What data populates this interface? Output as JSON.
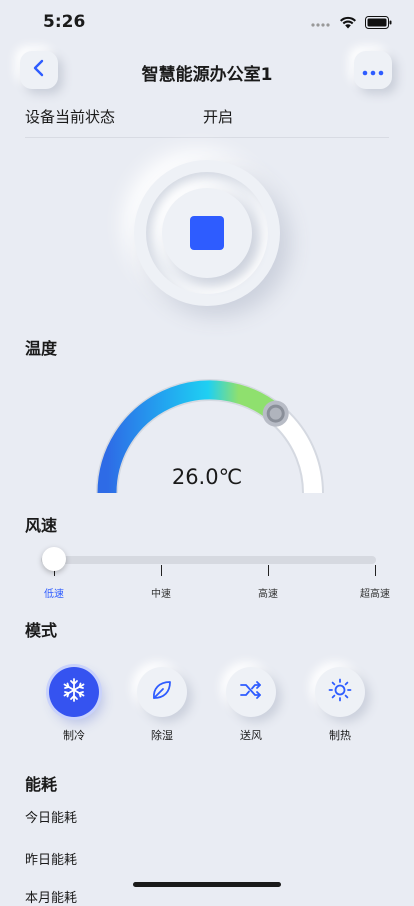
{
  "status_bar": {
    "time": "5:26"
  },
  "header": {
    "title": "智慧能源办公室1"
  },
  "device_state": {
    "label": "设备当前状态",
    "value": "开启"
  },
  "temperature": {
    "section_title": "温度",
    "value_text": "26.0℃",
    "level": 0.72
  },
  "fan_speed": {
    "section_title": "风速",
    "options": [
      "低速",
      "中速",
      "高速",
      "超高速"
    ],
    "selected_index": 0
  },
  "mode": {
    "section_title": "模式",
    "items": [
      {
        "label": "制冷",
        "icon": "snowflake-icon",
        "active": true
      },
      {
        "label": "除湿",
        "icon": "leaf-icon",
        "active": false
      },
      {
        "label": "送风",
        "icon": "shuffle-icon",
        "active": false
      },
      {
        "label": "制热",
        "icon": "sun-icon",
        "active": false
      }
    ]
  },
  "energy": {
    "section_title": "能耗",
    "rows": [
      "今日能耗",
      "昨日能耗",
      "本月能耗"
    ]
  },
  "colors": {
    "accent": "#2e5cff",
    "background": "#e9ecf3",
    "gauge_start": "#2e6be6",
    "gauge_mid": "#1fd0f2",
    "gauge_end": "#8fe06e"
  }
}
